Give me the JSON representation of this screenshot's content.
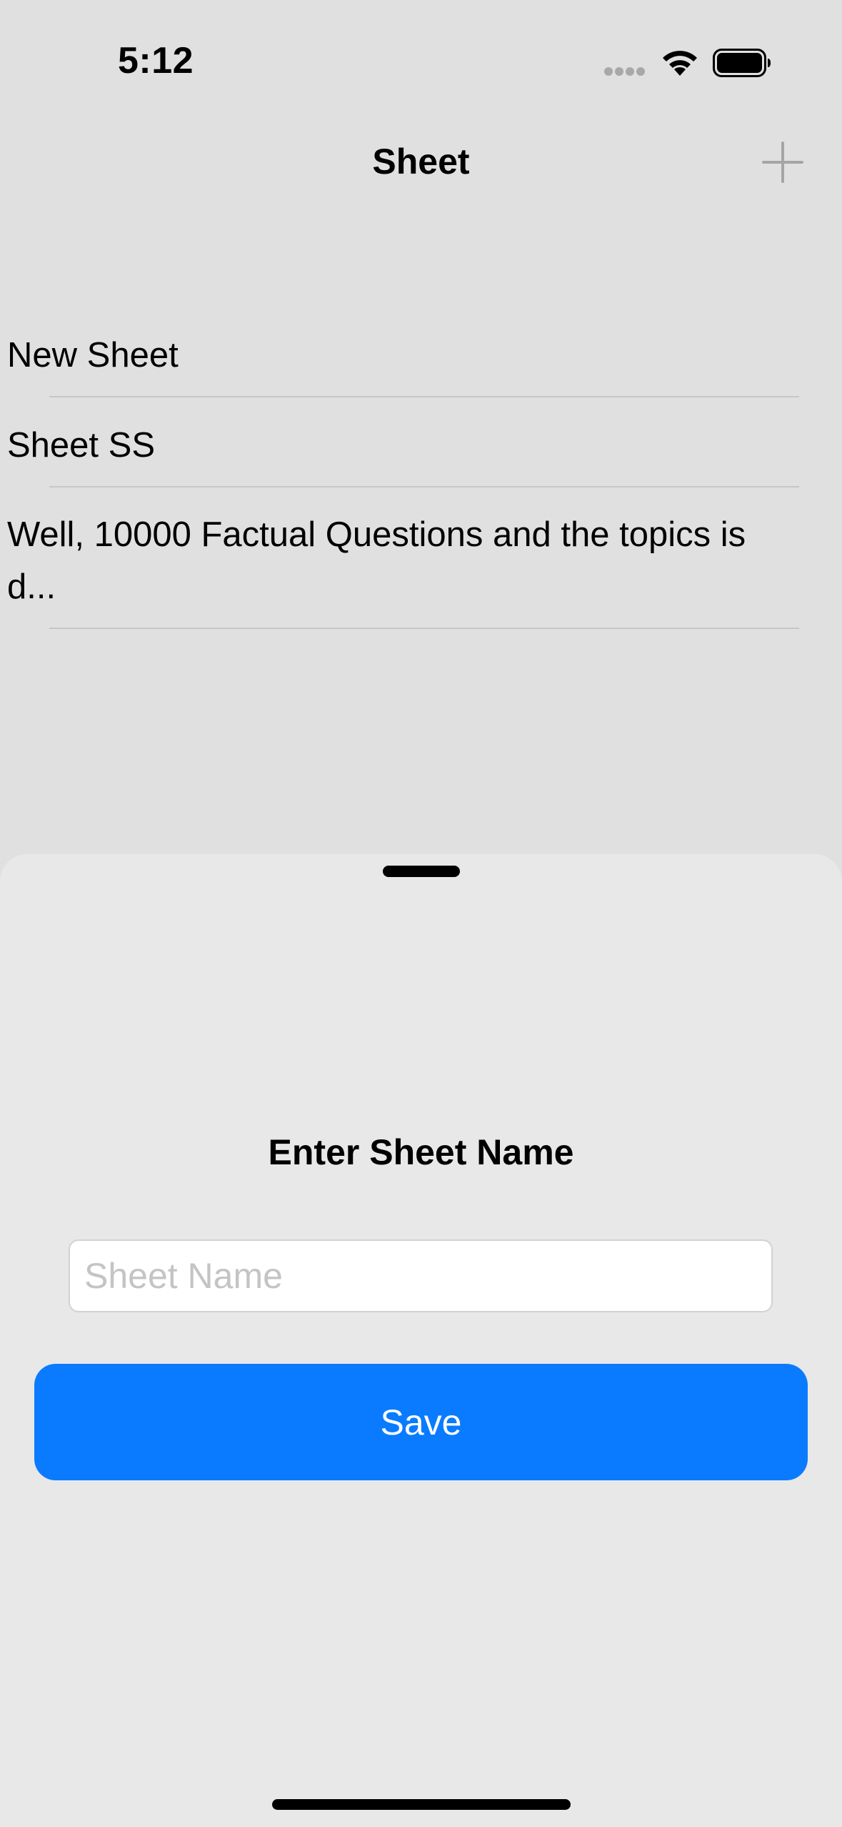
{
  "status_bar": {
    "time": "5:12",
    "icons": [
      "cellular-signal-icon",
      "wifi-icon",
      "battery-icon"
    ]
  },
  "nav": {
    "title": "Sheet",
    "add_icon": "plus-icon"
  },
  "list": {
    "items": [
      {
        "label": "New Sheet"
      },
      {
        "label": "Sheet SS"
      },
      {
        "label": "Well, 10000 Factual Questions and the topics is d..."
      }
    ]
  },
  "sheet": {
    "title": "Enter Sheet Name",
    "input_value": "",
    "input_placeholder": "Sheet Name",
    "save_label": "Save"
  },
  "colors": {
    "background": "#e0e0e0",
    "sheet_background": "#e8e8e9",
    "accent": "#0a7bfe",
    "divider": "#c6c6c8",
    "add_icon": "#a5a5a8"
  }
}
